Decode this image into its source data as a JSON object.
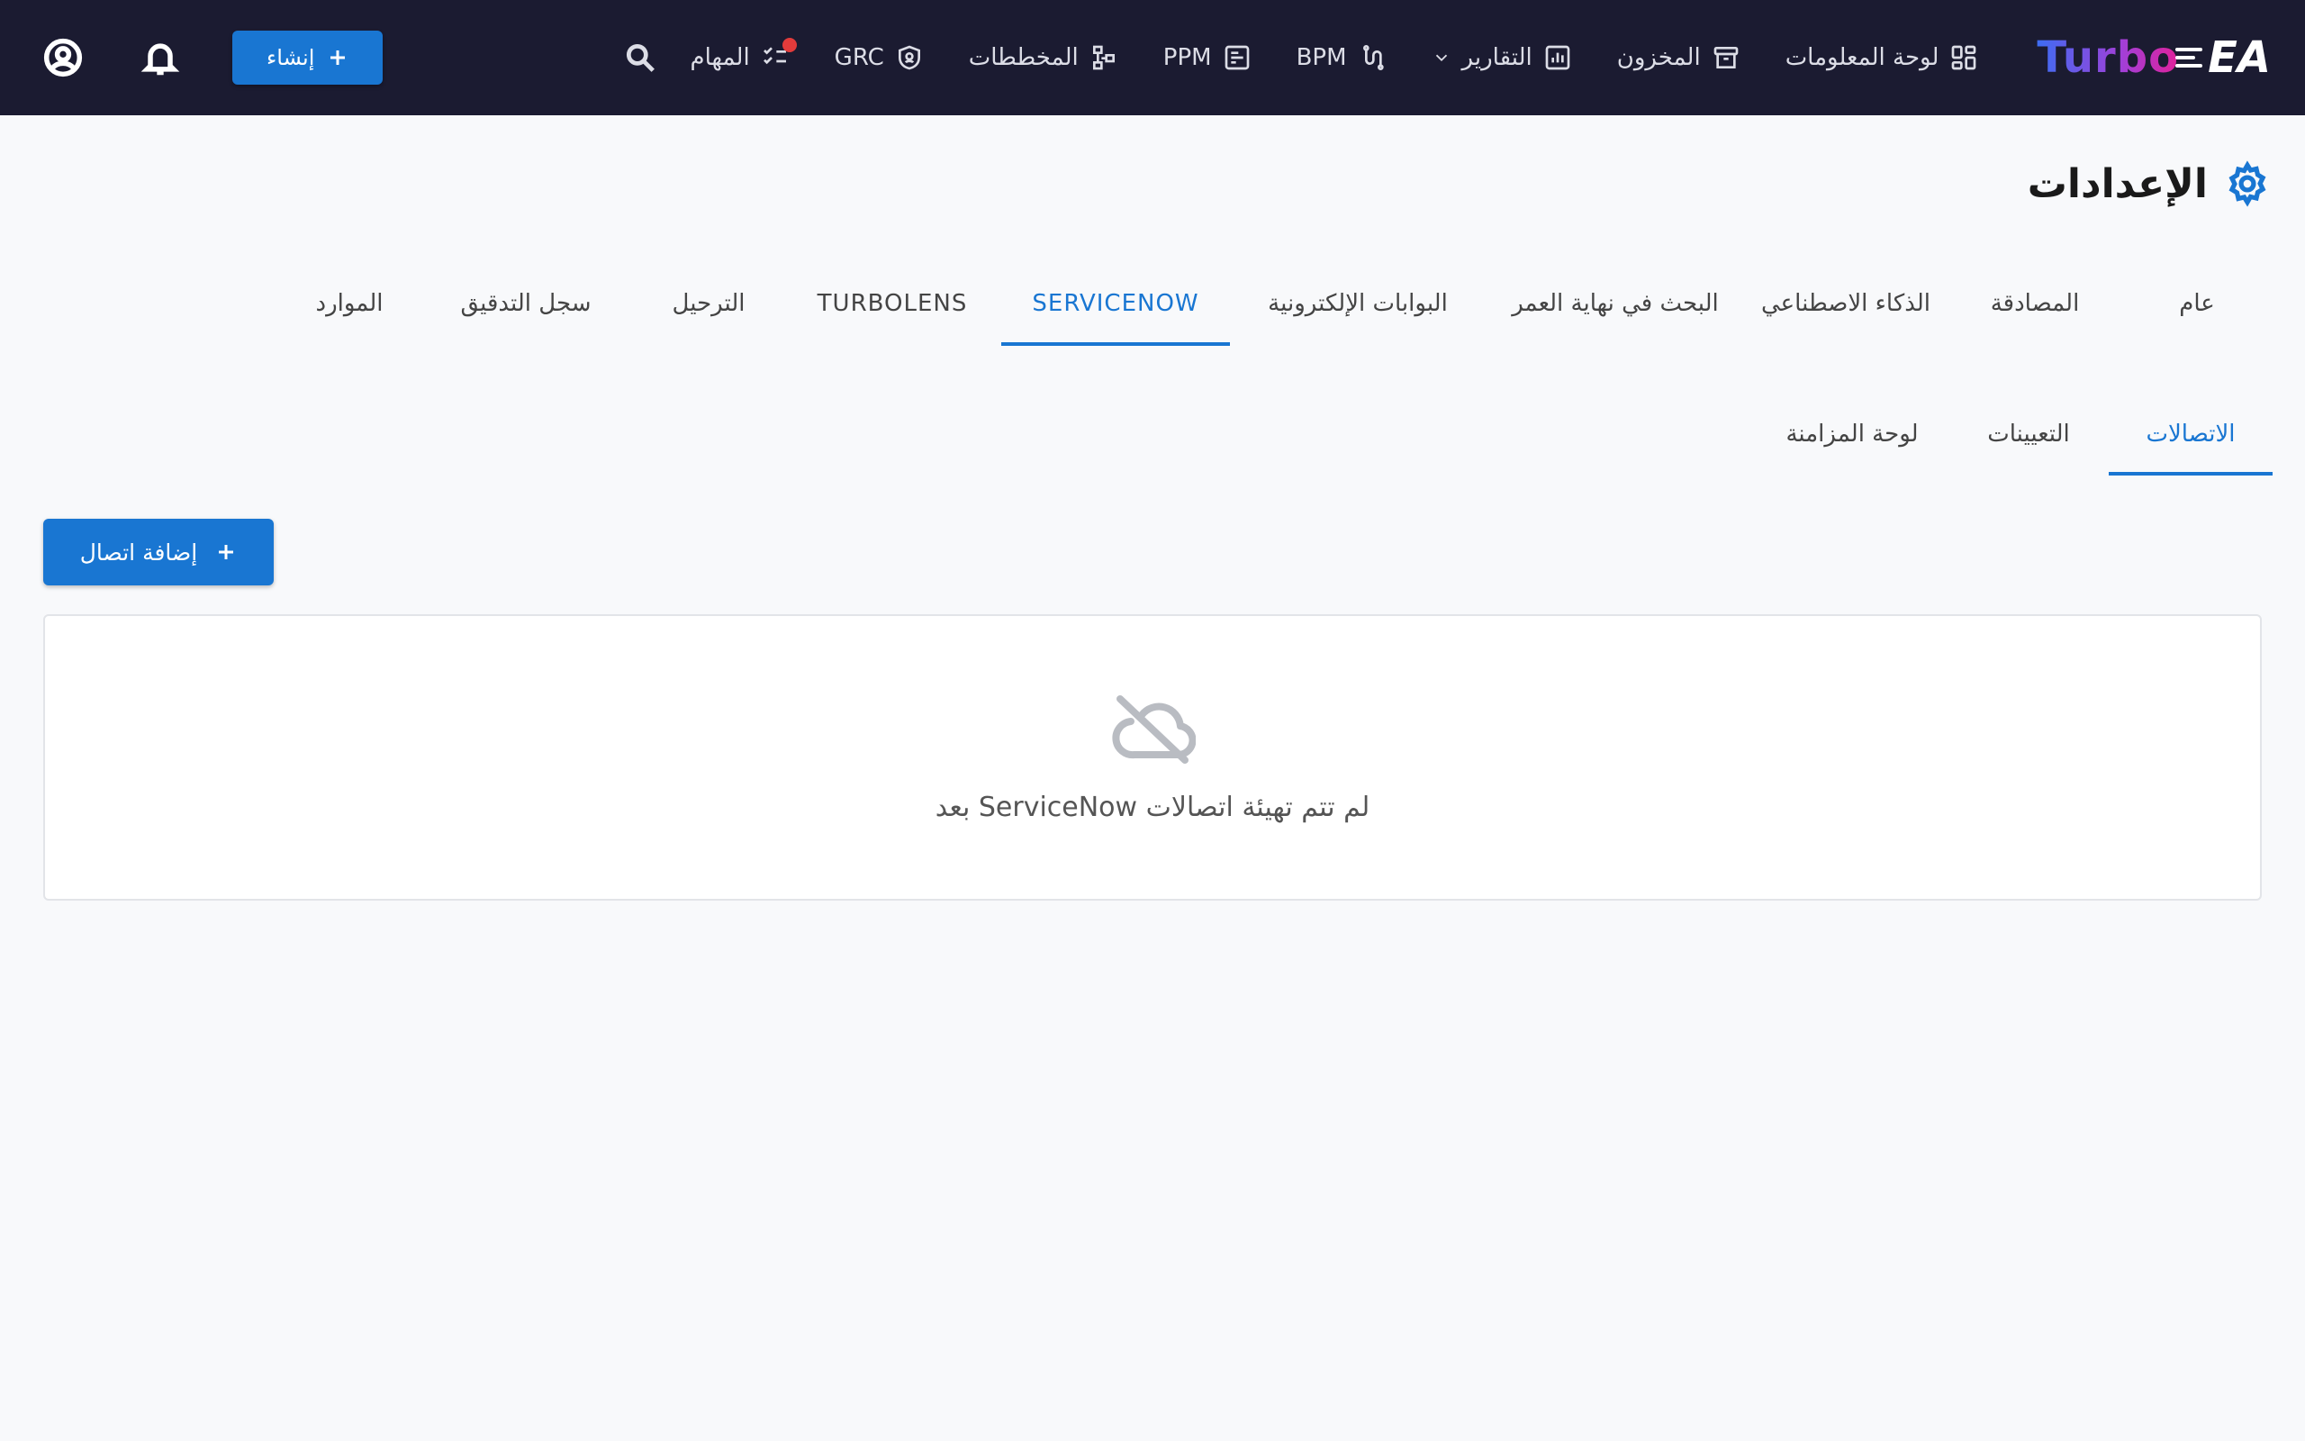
{
  "app": {
    "logo_text_1": "Turbo",
    "logo_text_2": "EA"
  },
  "nav": {
    "items": [
      {
        "label": "لوحة المعلومات",
        "icon": "dashboard-icon"
      },
      {
        "label": "المخزون",
        "icon": "archive-icon"
      },
      {
        "label": "التقارير",
        "icon": "chart-icon",
        "has_dropdown": true
      },
      {
        "label": "BPM",
        "icon": "flow-icon"
      },
      {
        "label": "PPM",
        "icon": "board-icon"
      },
      {
        "label": "المخططات",
        "icon": "diagram-icon"
      },
      {
        "label": "GRC",
        "icon": "shield-icon"
      },
      {
        "label": "المهام",
        "icon": "tasks-icon",
        "badge_color": "#e23b3b"
      }
    ],
    "create_label": "إنشاء"
  },
  "page": {
    "title": "الإعدادات"
  },
  "tabs": [
    {
      "label": "عام"
    },
    {
      "label": "المصادقة"
    },
    {
      "label": "الذكاء الاصطناعي"
    },
    {
      "label": "البحث في نهاية العمر"
    },
    {
      "label": "البوابات الإلكترونية"
    },
    {
      "label": "SERVICENOW",
      "active": true
    },
    {
      "label": "TURBOLENS"
    },
    {
      "label": "الترحيل"
    },
    {
      "label": "سجل التدقيق"
    },
    {
      "label": "الموارد"
    }
  ],
  "subtabs": [
    {
      "label": "الاتصالات",
      "active": true
    },
    {
      "label": "التعيينات"
    },
    {
      "label": "لوحة المزامنة"
    }
  ],
  "actions": {
    "add_connection_label": "إضافة اتصال"
  },
  "empty_state": {
    "icon": "cloud-off-icon",
    "message": "لم تتم تهيئة اتصالات ServiceNow بعد"
  },
  "colors": {
    "accent": "#1976d2",
    "topbar": "#1b1b31",
    "background": "#f8f9fb"
  }
}
